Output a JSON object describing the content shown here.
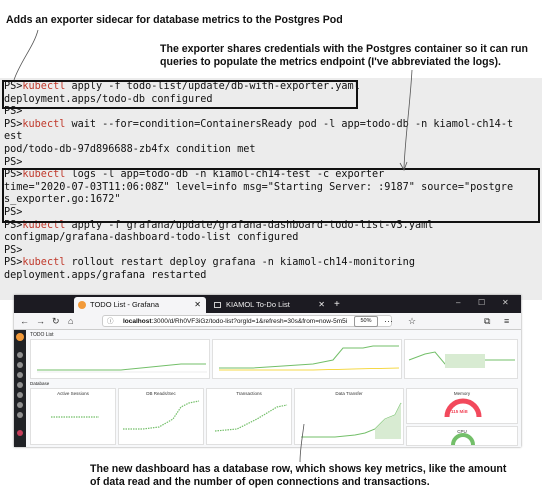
{
  "annotations": {
    "top_left": "Adds an exporter sidecar for database metrics to the Postgres Pod",
    "top_right": "The exporter shares credentials with the Postgres container so it can run queries to populate the metrics endpoint (I've abbreviated the logs).",
    "bottom": "The new dashboard has a database row, which shows key metrics, like the amount of data read and the number of open connections and transactions."
  },
  "terminal": {
    "prompt": "PS>",
    "lines": [
      {
        "cmd": "kubectl",
        "rest": " apply -f todo-list/update/db-with-exporter.yaml"
      },
      {
        "out": "deployment.apps/todo-db configured"
      },
      {
        "out": "PS>"
      },
      {
        "cmd": "kubectl",
        "rest": " wait --for=condition=ContainersReady pod -l app=todo-db -n kiamol-ch14-t"
      },
      {
        "out": "est"
      },
      {
        "out": "pod/todo-db-97d896688-zb4fx condition met"
      },
      {
        "out": "PS>"
      },
      {
        "cmd": "kubectl",
        "rest": " logs -l app=todo-db -n kiamol-ch14-test -c exporter"
      },
      {
        "out": "time=\"2020-07-03T11:06:08Z\" level=info msg=\"Starting Server: :9187\" source=\"postgre"
      },
      {
        "out": "s_exporter.go:1672\""
      },
      {
        "out": "PS>"
      },
      {
        "cmd": "kubectl",
        "rest": " apply -f grafana/update/grafana-dashboard-todo-list-v3.yaml"
      },
      {
        "out": "configmap/grafana-dashboard-todo-list configured"
      },
      {
        "out": "PS>"
      },
      {
        "cmd": "kubectl",
        "rest": " rollout restart deploy grafana -n kiamol-ch14-monitoring"
      },
      {
        "out": "deployment.apps/grafana restarted"
      }
    ]
  },
  "browser": {
    "tabs": [
      "TODO List - Grafana",
      "KIAMOL To-Do List"
    ],
    "new_tab": "+",
    "url_host": "localhost",
    "url_rest": ":3000/d/Rh0VF3iGz/todo-list?orgId=1&refresh=30s&from=now-5m5i",
    "zoom": "50%",
    "dashboard_title": "TODO List",
    "row_title": "Database",
    "panels": [
      "Active Sessions",
      "DB Reads/Sec",
      "Transactions",
      "Data Transfer",
      "Memory",
      "CPU"
    ],
    "gauge_value": "115 MiB",
    "accent": "#f2495c",
    "green": "#73bf69"
  }
}
